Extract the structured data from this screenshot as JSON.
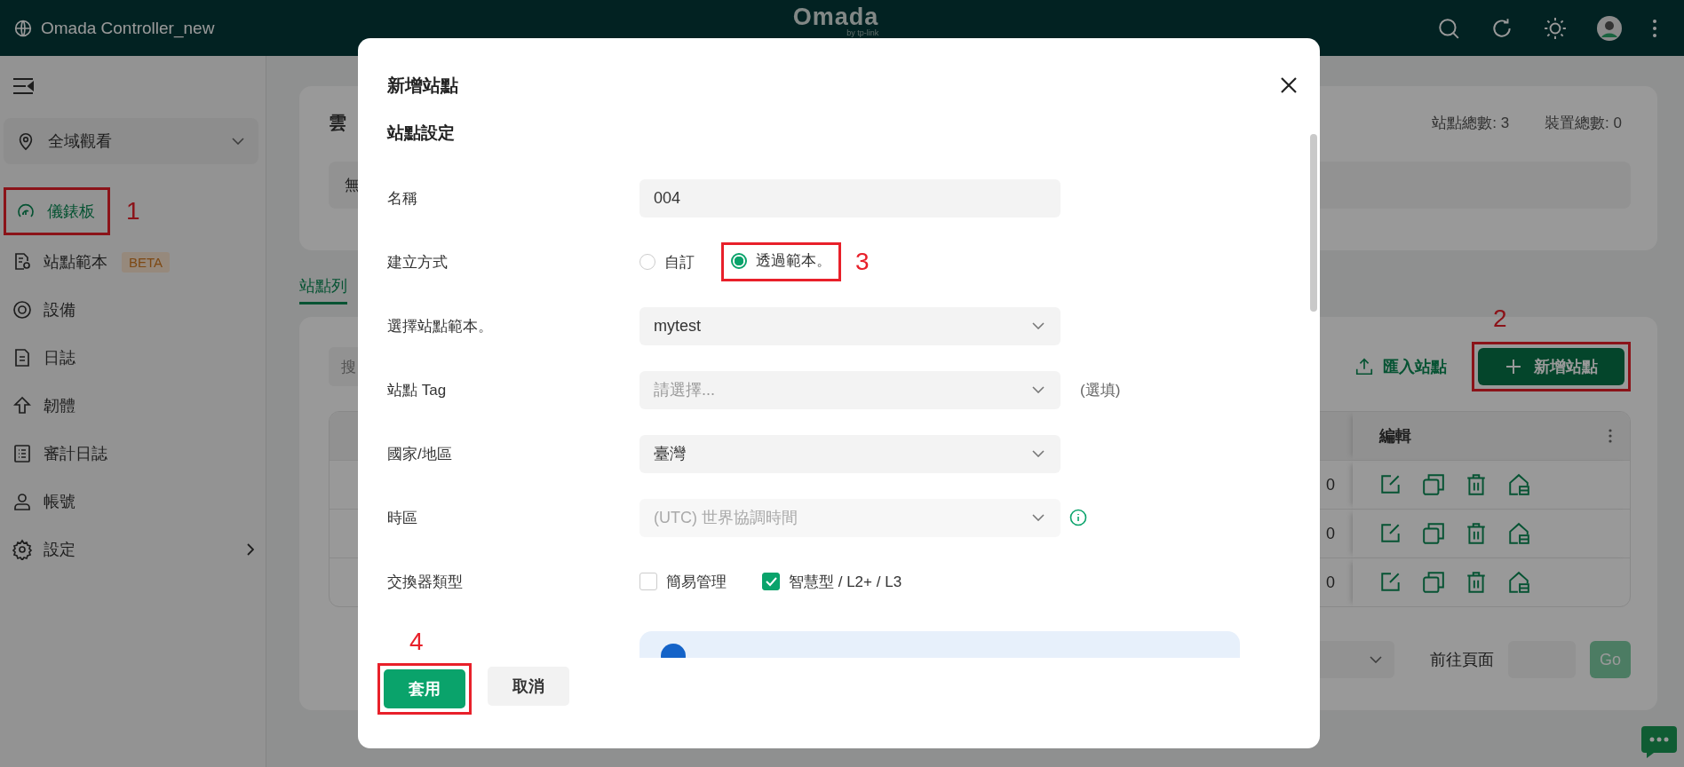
{
  "top_bar": {
    "title": "Omada Controller_new",
    "logo": "Omada",
    "logo_sub": "by tp-link"
  },
  "sidebar": {
    "site_selector": "全域觀看",
    "items": [
      {
        "label": "儀錶板",
        "selected": true,
        "callout": "1"
      },
      {
        "label": "站點範本",
        "badge": "BETA",
        "selected": false
      },
      {
        "label": "設備",
        "selected": false
      },
      {
        "label": "日誌",
        "selected": false
      },
      {
        "label": "韌體",
        "selected": false
      },
      {
        "label": "審計日誌",
        "selected": false
      },
      {
        "label": "帳號",
        "selected": false
      },
      {
        "label": "設定",
        "selected": false,
        "has_submenu": true
      }
    ]
  },
  "overview": {
    "title_fragment": "雲",
    "totals": [
      "站點總數: 3",
      "裝置總數: 0"
    ],
    "notice_fragment": "無"
  },
  "tabs": [
    {
      "label": "站點列",
      "selected": true
    }
  ],
  "site_list": {
    "search_fragment": "搜",
    "import_button": "匯入站點",
    "add_button": {
      "label": "新增站點",
      "callout": "2"
    },
    "edit_column": "編輯",
    "rows": [
      {
        "cell": "0"
      },
      {
        "cell": "0"
      },
      {
        "cell": "0"
      }
    ],
    "goto_label": "前往頁面",
    "go_button": "Go"
  },
  "dialog": {
    "title": "新增站點",
    "section": "站點設定",
    "fields": [
      {
        "kind": "text",
        "label": "名稱",
        "value": "004"
      },
      {
        "kind": "radio",
        "label": "建立方式",
        "options": [
          {
            "label": "自訂",
            "selected": false
          },
          {
            "label": "透過範本。",
            "selected": true,
            "callout": "3"
          }
        ]
      },
      {
        "kind": "select",
        "label": "選擇站點範本。",
        "value": "mytest"
      },
      {
        "kind": "select",
        "label": "站點 Tag",
        "placeholder": "請選擇...",
        "suffix": "(選填)"
      },
      {
        "kind": "select",
        "label": "國家/地區",
        "value": "臺灣"
      },
      {
        "kind": "select",
        "label": "時區",
        "value": "(UTC) 世界協調時間",
        "disabled": true,
        "info": true
      },
      {
        "kind": "checkbox",
        "label": "交換器類型",
        "options": [
          {
            "label": "簡易管理",
            "checked": false
          },
          {
            "label": "智慧型 / L2+ / L3",
            "checked": true
          }
        ]
      }
    ],
    "buttons": [
      {
        "label": "套用",
        "kind": "primary",
        "callout": "4"
      },
      {
        "label": "取消",
        "kind": "secondary"
      }
    ]
  }
}
